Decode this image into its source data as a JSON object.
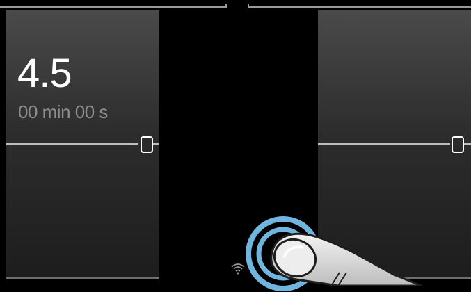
{
  "left_panel": {
    "power_level": "4.5",
    "timer": "00 min 00 s"
  },
  "icons": {
    "status": "wifi-icon",
    "gesture": "finger-tap-icon"
  },
  "colors": {
    "background": "#000000",
    "panel_top": "#4a4a4a",
    "panel_bottom": "#1d1d1d",
    "touch_ring": "#6fb5dd",
    "text_primary": "#ffffff",
    "text_secondary": "#8d8d8d"
  }
}
